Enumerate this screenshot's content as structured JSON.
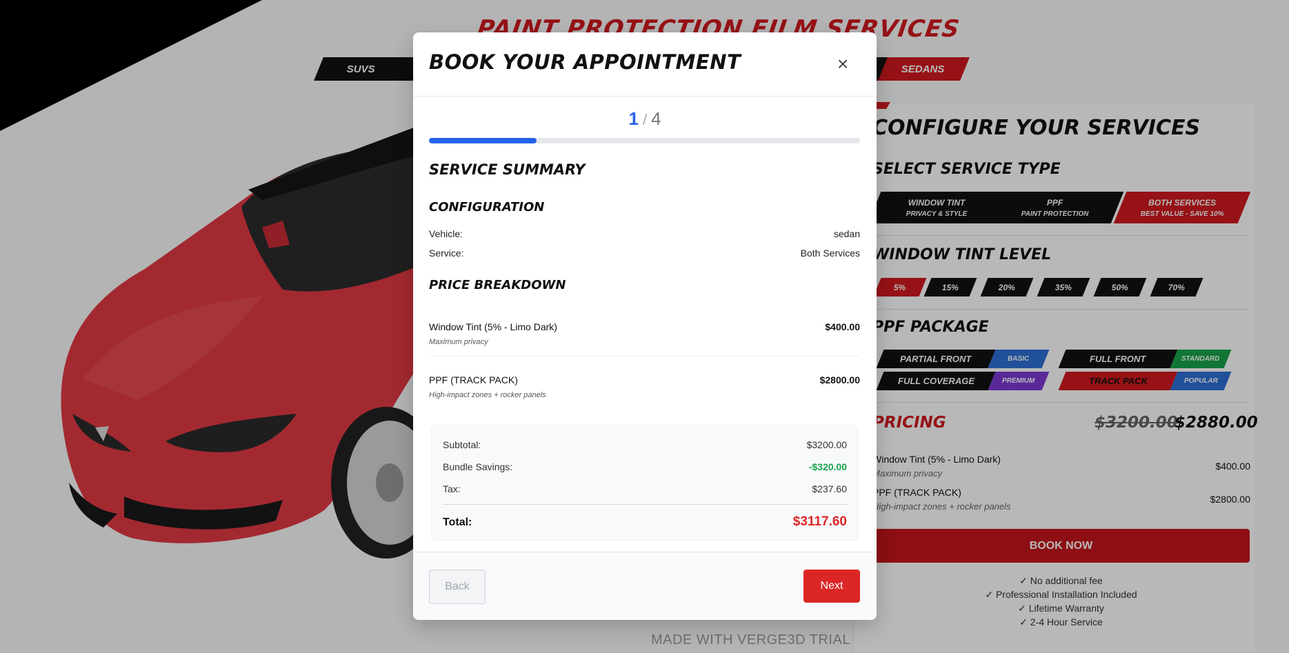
{
  "background": {
    "page_title": "PAINT PROTECTION FILM SERVICES",
    "vehicle_tabs": [
      {
        "label": "SUVS",
        "selected": false
      },
      {
        "label": "SEDANS",
        "selected": true
      }
    ],
    "configurator": {
      "title": "CONFIGURE YOUR SERVICES",
      "service_type_title": "SELECT SERVICE TYPE",
      "service_types": [
        {
          "label": "WINDOW TINT",
          "sub": "PRIVACY & STYLE",
          "selected": false
        },
        {
          "label": "PPF",
          "sub": "PAINT PROTECTION",
          "selected": false
        },
        {
          "label": "BOTH SERVICES",
          "sub": "BEST VALUE - SAVE 10%",
          "selected": true
        }
      ],
      "tint_title": "WINDOW TINT LEVEL",
      "tint_levels": [
        "5%",
        "15%",
        "20%",
        "35%",
        "50%",
        "70%"
      ],
      "tint_selected": "5%",
      "ppf_title": "PPF PACKAGE",
      "ppf_packages": [
        {
          "name": "PARTIAL FRONT",
          "tag": "BASIC",
          "tag_color": "#2f6fd6",
          "selected": false
        },
        {
          "name": "FULL FRONT",
          "tag": "STANDARD",
          "tag_color": "#17a34a",
          "selected": false
        },
        {
          "name": "FULL COVERAGE",
          "tag": "PREMIUM",
          "tag_color": "#7c3ad6",
          "selected": false
        },
        {
          "name": "TRACK PACK",
          "tag": "POPULAR",
          "tag_color": "#2f6fd6",
          "selected": true
        }
      ],
      "pricing_label": "PRICING",
      "price_original": "$3200.00",
      "price_discounted": "$2880.00",
      "items": [
        {
          "name": "Window Tint (5% - Limo Dark)",
          "desc": "Maximum privacy",
          "price": "$400.00"
        },
        {
          "name": "PPF (TRACK PACK)",
          "desc": "High-impact zones + rocker panels",
          "price": "$2800.00"
        }
      ],
      "book_now": "BOOK NOW",
      "perks": [
        "✓ No additional fee",
        "✓ Professional Installation Included",
        "✓ Lifetime Warranty",
        "✓ 2-4 Hour Service"
      ]
    },
    "watermark": "MADE WITH VERGE3D TRIAL"
  },
  "modal": {
    "title": "BOOK YOUR APPOINTMENT",
    "close_icon": "×",
    "step_current": "1",
    "step_separator": "/",
    "step_total": "4",
    "progress_fraction": 0.25,
    "summary_title": "SERVICE SUMMARY",
    "configuration_title": "CONFIGURATION",
    "vehicle_label": "Vehicle:",
    "vehicle_value": "sedan",
    "service_label": "Service:",
    "service_value": "Both Services",
    "price_breakdown_title": "PRICE BREAKDOWN",
    "items": [
      {
        "name": "Window Tint (5% - Limo Dark)",
        "desc": "Maximum privacy",
        "price": "$400.00"
      },
      {
        "name": "PPF (TRACK PACK)",
        "desc": "High-impact zones + rocker panels",
        "price": "$2800.00"
      }
    ],
    "subtotal_label": "Subtotal:",
    "subtotal_value": "$3200.00",
    "savings_label": "Bundle Savings:",
    "savings_value": "-$320.00",
    "tax_label": "Tax:",
    "tax_value": "$237.60",
    "total_label": "Total:",
    "total_value": "$3117.60",
    "back_label": "Back",
    "next_label": "Next"
  },
  "colors": {
    "accent_red": "#dc2626",
    "brand_red": "#d0191f",
    "progress_blue": "#2563eb",
    "savings_green": "#16a34a"
  }
}
